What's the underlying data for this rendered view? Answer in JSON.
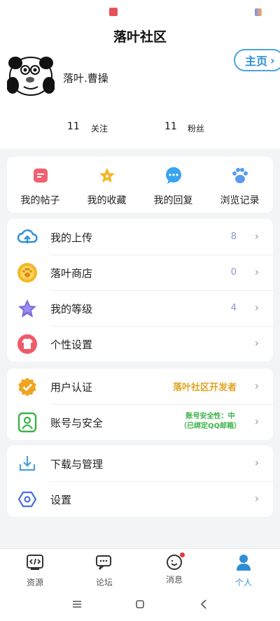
{
  "app": {
    "title": "落叶社区",
    "home_button": "主页"
  },
  "profile": {
    "username": "落叶.曹操",
    "following_count": "11",
    "following_label": "关注",
    "followers_count": "11",
    "followers_label": "粉丝"
  },
  "quick_actions": [
    {
      "label": "我的帖子",
      "icon": "post-icon",
      "color": "#f0606f"
    },
    {
      "label": "我的收藏",
      "icon": "star-icon",
      "color": "#f6b623"
    },
    {
      "label": "我的回复",
      "icon": "chat-bubble-icon",
      "color": "#3aa3ef"
    },
    {
      "label": "浏览记录",
      "icon": "paw-icon",
      "color": "#5b9bef"
    }
  ],
  "menu_group1": [
    {
      "label": "我的上传",
      "count": "8",
      "icon": "cloud-upload-icon"
    },
    {
      "label": "落叶商店",
      "count": "0",
      "icon": "paw-coin-icon"
    },
    {
      "label": "我的等级",
      "count": "4",
      "icon": "purple-star-icon"
    },
    {
      "label": "个性设置",
      "count": "",
      "icon": "tshirt-icon"
    }
  ],
  "menu_group2": {
    "verify": {
      "label": "用户认证",
      "value": "落叶社区开发者",
      "icon": "badge-check-icon"
    },
    "security": {
      "label": "账号与安全",
      "value_line1": "账号安全性：中",
      "value_line2": "（已绑定QQ邮箱）",
      "icon": "user-card-icon"
    }
  },
  "menu_group3": [
    {
      "label": "下载与管理",
      "icon": "download-icon"
    },
    {
      "label": "设置",
      "icon": "hexagon-settings-icon"
    }
  ],
  "tabbar": [
    {
      "label": "资源",
      "icon": "code-icon",
      "active": false
    },
    {
      "label": "论坛",
      "icon": "forum-icon",
      "active": false
    },
    {
      "label": "消息",
      "icon": "message-icon",
      "active": false
    },
    {
      "label": "个人",
      "icon": "person-icon",
      "active": true
    }
  ],
  "colors": {
    "accent": "#2f8fd4",
    "verify": "#e2a321",
    "secure": "#3bb34a"
  }
}
